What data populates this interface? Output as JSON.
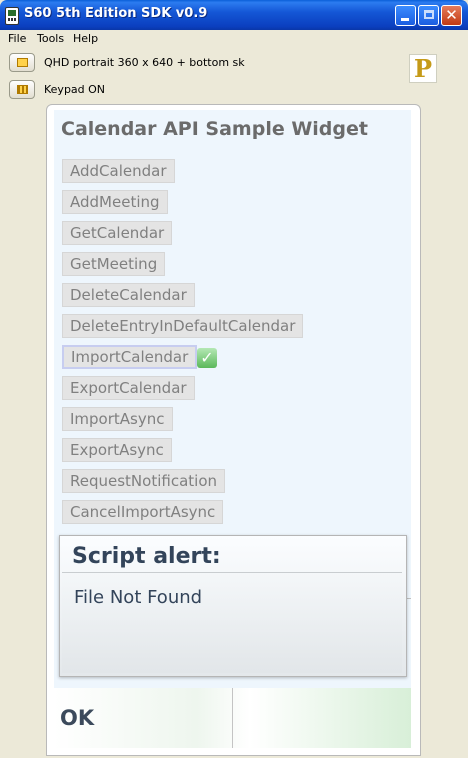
{
  "window": {
    "title": "S60 5th Edition SDK v0.9"
  },
  "menu": {
    "items": [
      "File",
      "Tools",
      "Help"
    ]
  },
  "toolbar": {
    "resolution_label": "QHD portrait 360 x 640 + bottom sk",
    "keypad_label": "Keypad ON"
  },
  "widget": {
    "title": "Calendar API Sample Widget",
    "buttons": [
      "AddCalendar",
      "AddMeeting",
      "GetCalendar",
      "GetMeeting",
      "DeleteCalendar",
      "DeleteEntryInDefaultCalendar",
      "ImportCalendar",
      "ExportCalendar",
      "ImportAsync",
      "ExportAsync",
      "RequestNotification",
      "CancelImportAsync"
    ],
    "focused_button": "ImportCalendar"
  },
  "alert": {
    "title": "Script alert:",
    "message": "File Not Found"
  },
  "softkeys": {
    "left_label": "OK"
  },
  "icons": {
    "app": "phone-app-icon",
    "resolution": "screen-orientation-icon",
    "keypad": "keypad-icon",
    "logo": "p-logo-icon",
    "check": "check-icon"
  }
}
